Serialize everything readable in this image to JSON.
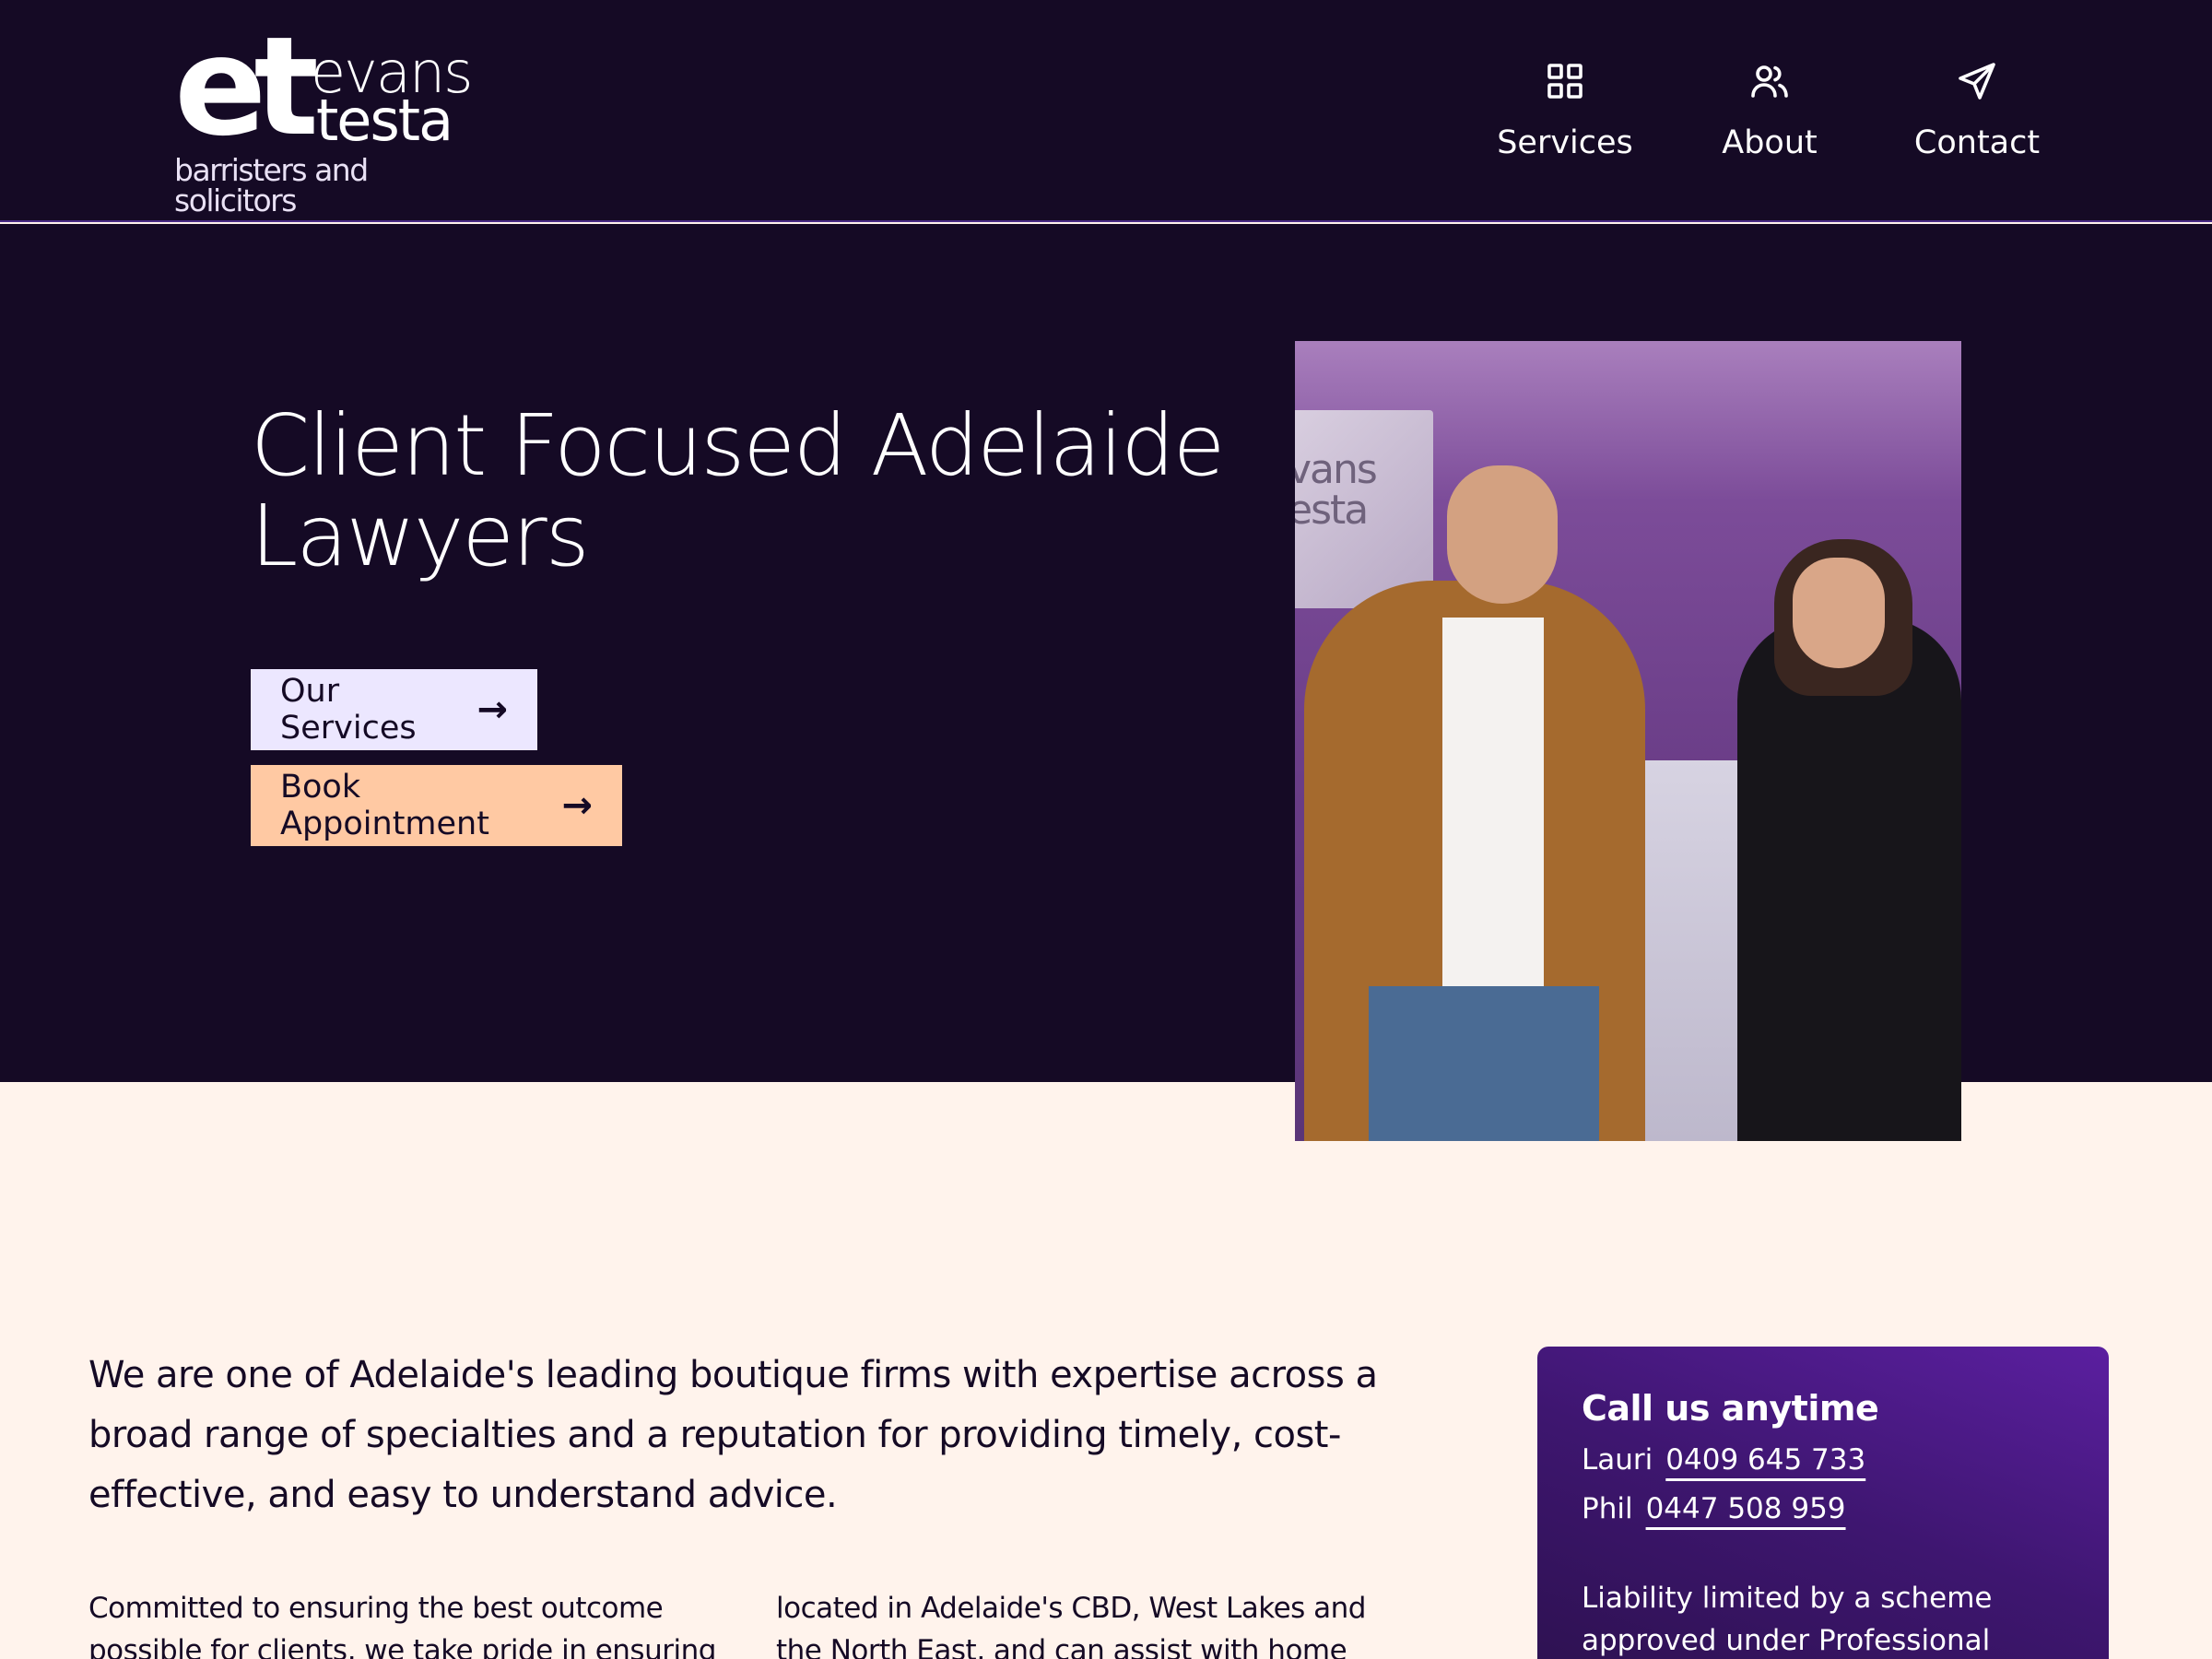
{
  "brand": {
    "logo_mark": "et",
    "name_line1": "evans",
    "name_line2": "testa",
    "tagline": "barristers and solicitors"
  },
  "nav": {
    "items": [
      {
        "label": "Services",
        "icon": "grid-icon"
      },
      {
        "label": "About",
        "icon": "users-icon"
      },
      {
        "label": "Contact",
        "icon": "send-icon"
      }
    ]
  },
  "hero": {
    "title_line1": "Client Focused Adelaide",
    "title_line2": "Lawyers",
    "btn_services": "Our Services",
    "btn_book": "Book Appointment",
    "photo_sign_line1": "vans",
    "photo_sign_line2": "esta"
  },
  "intro": {
    "lead": "We are one of Adelaide's leading boutique firms with expertise across a broad range of specialties and a reputation for providing timely, cost-effective, and easy to understand advice.",
    "col1": "Committed to ensuring the best outcome possible for clients, we take pride in ensuring your",
    "col2": "located in Adelaide's CBD, West Lakes and the North East, and can assist with home visits where"
  },
  "call": {
    "title": "Call us anytime",
    "contacts": [
      {
        "name": "Lauri",
        "phone": "0409 645 733"
      },
      {
        "name": "Phil",
        "phone": "0447 508 959"
      }
    ],
    "note": "Liability limited by a scheme approved under Professional"
  },
  "colors": {
    "navy": "#150a25",
    "cream": "#fff3ec",
    "lavender": "#ece7ff",
    "peach": "#ffc9a3",
    "purple": "#5b1fa0"
  }
}
